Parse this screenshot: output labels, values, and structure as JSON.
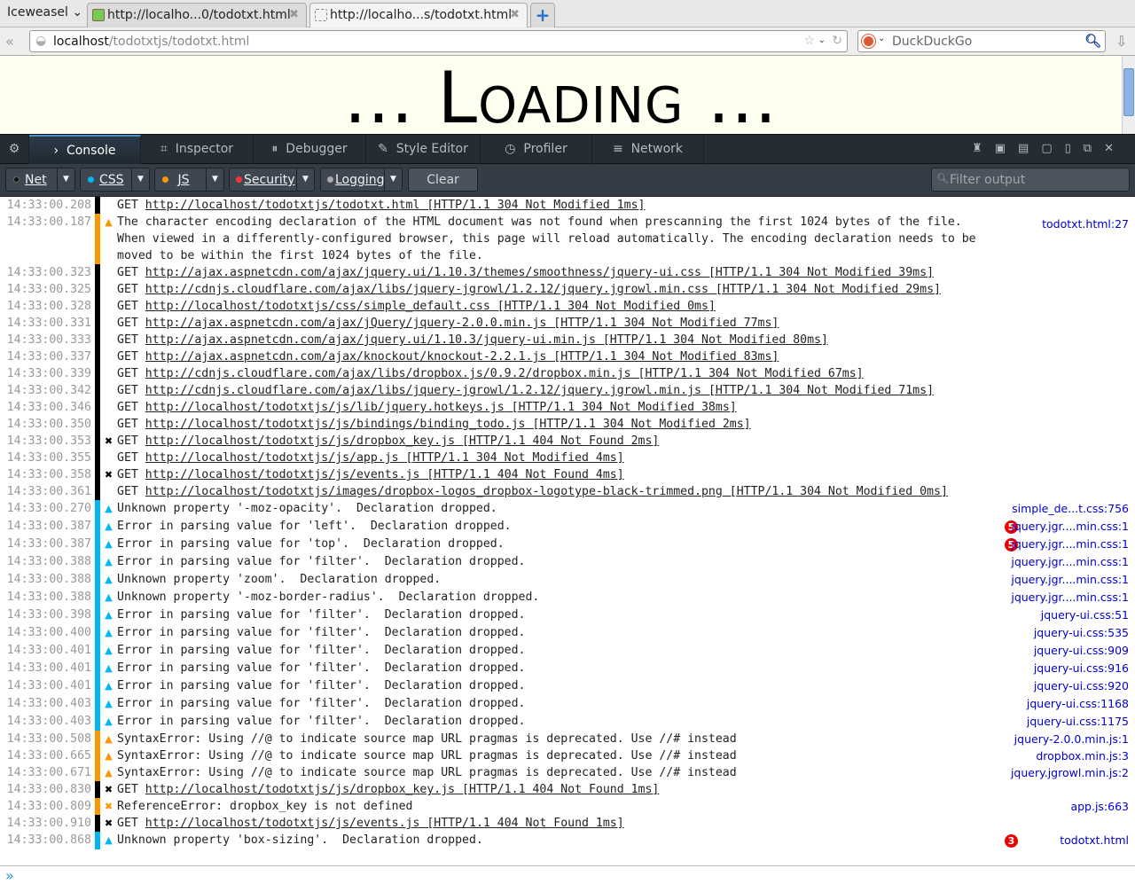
{
  "browser": {
    "app_menu": "Iceweasel",
    "tabs": [
      {
        "label": "http://localho...0/todotxt.html",
        "active": false
      },
      {
        "label": "http://localho...s/todotxt.html",
        "active": true
      }
    ],
    "url_host": "localhost",
    "url_path": "/todotxtjs/todotxt.html",
    "search_engine": "DuckDuckGo"
  },
  "page": {
    "loading_text": "... Loading ..."
  },
  "devtools": {
    "tools": [
      "Console",
      "Inspector",
      "Debugger",
      "Style Editor",
      "Profiler",
      "Network"
    ],
    "selected": "Console",
    "filters": [
      {
        "label": "Net",
        "color": "#222222"
      },
      {
        "label": "CSS",
        "color": "#00b6f0"
      },
      {
        "label": "JS",
        "color": "#fb9500"
      },
      {
        "label": "Security",
        "color": "#ff3333"
      },
      {
        "label": "Logging",
        "color": "#aaaaaa"
      }
    ],
    "clear_label": "Clear",
    "filter_placeholder": "Filter output"
  },
  "colors": {
    "net": "#000000",
    "js": "#fb9500",
    "css": "#00b6f0"
  },
  "log": [
    {
      "time": "14:33:00.208",
      "cat": "net",
      "icon": "",
      "pre": "GET ",
      "link": "http://localhost/todotxtjs/todotxt.html",
      "post": " [HTTP/1.1 304 Not Modified 1ms]",
      "loc": "",
      "badge": ""
    },
    {
      "time": "14:33:00.187",
      "cat": "js",
      "icon": "warn",
      "pre": "The character encoding declaration of the HTML document was not found when prescanning the first 1024 bytes of the file. When viewed in a differently-configured browser, this page will reload automatically. The encoding declaration needs to be moved to be within the first 1024 bytes of the file.",
      "link": "",
      "post": "",
      "loc": "todotxt.html:27",
      "badge": ""
    },
    {
      "time": "14:33:00.323",
      "cat": "net",
      "icon": "",
      "pre": "GET ",
      "link": "http://ajax.aspnetcdn.com/ajax/jquery.ui/1.10.3/themes/smoothness/jquery-ui.css",
      "post": " [HTTP/1.1 304 Not Modified 39ms]",
      "loc": "",
      "badge": ""
    },
    {
      "time": "14:33:00.325",
      "cat": "net",
      "icon": "",
      "pre": "GET ",
      "link": "http://cdnjs.cloudflare.com/ajax/libs/jquery-jgrowl/1.2.12/jquery.jgrowl.min.css",
      "post": " [HTTP/1.1 304 Not Modified 29ms]",
      "loc": "",
      "badge": ""
    },
    {
      "time": "14:33:00.328",
      "cat": "net",
      "icon": "",
      "pre": "GET ",
      "link": "http://localhost/todotxtjs/css/simple_default.css",
      "post": " [HTTP/1.1 304 Not Modified 0ms]",
      "loc": "",
      "badge": ""
    },
    {
      "time": "14:33:00.331",
      "cat": "net",
      "icon": "",
      "pre": "GET ",
      "link": "http://ajax.aspnetcdn.com/ajax/jQuery/jquery-2.0.0.min.js",
      "post": " [HTTP/1.1 304 Not Modified 77ms]",
      "loc": "",
      "badge": ""
    },
    {
      "time": "14:33:00.333",
      "cat": "net",
      "icon": "",
      "pre": "GET ",
      "link": "http://ajax.aspnetcdn.com/ajax/jquery.ui/1.10.3/jquery-ui.min.js",
      "post": " [HTTP/1.1 304 Not Modified 80ms]",
      "loc": "",
      "badge": ""
    },
    {
      "time": "14:33:00.337",
      "cat": "net",
      "icon": "",
      "pre": "GET ",
      "link": "http://ajax.aspnetcdn.com/ajax/knockout/knockout-2.2.1.js",
      "post": " [HTTP/1.1 304 Not Modified 83ms]",
      "loc": "",
      "badge": ""
    },
    {
      "time": "14:33:00.339",
      "cat": "net",
      "icon": "",
      "pre": "GET ",
      "link": "http://cdnjs.cloudflare.com/ajax/libs/dropbox.js/0.9.2/dropbox.min.js",
      "post": " [HTTP/1.1 304 Not Modified 67ms]",
      "loc": "",
      "badge": ""
    },
    {
      "time": "14:33:00.342",
      "cat": "net",
      "icon": "",
      "pre": "GET ",
      "link": "http://cdnjs.cloudflare.com/ajax/libs/jquery-jgrowl/1.2.12/jquery.jgrowl.min.js",
      "post": " [HTTP/1.1 304 Not Modified 71ms]",
      "loc": "",
      "badge": ""
    },
    {
      "time": "14:33:00.346",
      "cat": "net",
      "icon": "",
      "pre": "GET ",
      "link": "http://localhost/todotxtjs/js/lib/jquery.hotkeys.js",
      "post": " [HTTP/1.1 304 Not Modified 38ms]",
      "loc": "",
      "badge": ""
    },
    {
      "time": "14:33:00.350",
      "cat": "net",
      "icon": "",
      "pre": "GET ",
      "link": "http://localhost/todotxtjs/js/bindings/binding_todo.js",
      "post": " [HTTP/1.1 304 Not Modified 2ms]",
      "loc": "",
      "badge": ""
    },
    {
      "time": "14:33:00.353",
      "cat": "net",
      "icon": "error",
      "pre": "GET ",
      "link": "http://localhost/todotxtjs/js/dropbox_key.js",
      "post": " [HTTP/1.1 404 Not Found 2ms]",
      "loc": "",
      "badge": ""
    },
    {
      "time": "14:33:00.355",
      "cat": "net",
      "icon": "",
      "pre": "GET ",
      "link": "http://localhost/todotxtjs/js/app.js",
      "post": " [HTTP/1.1 304 Not Modified 4ms]",
      "loc": "",
      "badge": ""
    },
    {
      "time": "14:33:00.358",
      "cat": "net",
      "icon": "error",
      "pre": "GET ",
      "link": "http://localhost/todotxtjs/js/events.js",
      "post": " [HTTP/1.1 404 Not Found 4ms]",
      "loc": "",
      "badge": ""
    },
    {
      "time": "14:33:00.361",
      "cat": "net",
      "icon": "",
      "pre": "GET ",
      "link": "http://localhost/todotxtjs/images/dropbox-logos_dropbox-logotype-black-trimmed.png",
      "post": " [HTTP/1.1 304 Not Modified 0ms]",
      "loc": "",
      "badge": ""
    },
    {
      "time": "14:33:00.270",
      "cat": "css",
      "icon": "warn",
      "pre": "Unknown property '-moz-opacity'.  Declaration dropped.",
      "link": "",
      "post": "",
      "loc": "simple_de...t.css:756",
      "badge": ""
    },
    {
      "time": "14:33:00.387",
      "cat": "css",
      "icon": "warn",
      "pre": "Error in parsing value for 'left'.  Declaration dropped.",
      "link": "",
      "post": "",
      "loc": "jquery.jgr....min.css:1",
      "badge": "5"
    },
    {
      "time": "14:33:00.387",
      "cat": "css",
      "icon": "warn",
      "pre": "Error in parsing value for 'top'.  Declaration dropped.",
      "link": "",
      "post": "",
      "loc": "jquery.jgr....min.css:1",
      "badge": "5"
    },
    {
      "time": "14:33:00.388",
      "cat": "css",
      "icon": "warn",
      "pre": "Error in parsing value for 'filter'.  Declaration dropped.",
      "link": "",
      "post": "",
      "loc": "jquery.jgr....min.css:1",
      "badge": ""
    },
    {
      "time": "14:33:00.388",
      "cat": "css",
      "icon": "warn",
      "pre": "Unknown property 'zoom'.  Declaration dropped.",
      "link": "",
      "post": "",
      "loc": "jquery.jgr....min.css:1",
      "badge": ""
    },
    {
      "time": "14:33:00.388",
      "cat": "css",
      "icon": "warn",
      "pre": "Unknown property '-moz-border-radius'.  Declaration dropped.",
      "link": "",
      "post": "",
      "loc": "jquery.jgr....min.css:1",
      "badge": ""
    },
    {
      "time": "14:33:00.398",
      "cat": "css",
      "icon": "warn",
      "pre": "Error in parsing value for 'filter'.  Declaration dropped.",
      "link": "",
      "post": "",
      "loc": "jquery-ui.css:51",
      "badge": ""
    },
    {
      "time": "14:33:00.400",
      "cat": "css",
      "icon": "warn",
      "pre": "Error in parsing value for 'filter'.  Declaration dropped.",
      "link": "",
      "post": "",
      "loc": "jquery-ui.css:535",
      "badge": ""
    },
    {
      "time": "14:33:00.401",
      "cat": "css",
      "icon": "warn",
      "pre": "Error in parsing value for 'filter'.  Declaration dropped.",
      "link": "",
      "post": "",
      "loc": "jquery-ui.css:909",
      "badge": ""
    },
    {
      "time": "14:33:00.401",
      "cat": "css",
      "icon": "warn",
      "pre": "Error in parsing value for 'filter'.  Declaration dropped.",
      "link": "",
      "post": "",
      "loc": "jquery-ui.css:916",
      "badge": ""
    },
    {
      "time": "14:33:00.401",
      "cat": "css",
      "icon": "warn",
      "pre": "Error in parsing value for 'filter'.  Declaration dropped.",
      "link": "",
      "post": "",
      "loc": "jquery-ui.css:920",
      "badge": ""
    },
    {
      "time": "14:33:00.403",
      "cat": "css",
      "icon": "warn",
      "pre": "Error in parsing value for 'filter'.  Declaration dropped.",
      "link": "",
      "post": "",
      "loc": "jquery-ui.css:1168",
      "badge": ""
    },
    {
      "time": "14:33:00.403",
      "cat": "css",
      "icon": "warn",
      "pre": "Error in parsing value for 'filter'.  Declaration dropped.",
      "link": "",
      "post": "",
      "loc": "jquery-ui.css:1175",
      "badge": ""
    },
    {
      "time": "14:33:00.508",
      "cat": "js",
      "icon": "warn",
      "pre": "SyntaxError: Using //@ to indicate source map URL pragmas is deprecated. Use //# instead",
      "link": "",
      "post": "",
      "loc": "jquery-2.0.0.min.js:1",
      "badge": ""
    },
    {
      "time": "14:33:00.665",
      "cat": "js",
      "icon": "warn",
      "pre": "SyntaxError: Using //@ to indicate source map URL pragmas is deprecated. Use //# instead",
      "link": "",
      "post": "",
      "loc": "dropbox.min.js:3",
      "badge": ""
    },
    {
      "time": "14:33:00.671",
      "cat": "js",
      "icon": "warn",
      "pre": "SyntaxError: Using //@ to indicate source map URL pragmas is deprecated. Use //# instead",
      "link": "",
      "post": "",
      "loc": "jquery.jgrowl.min.js:2",
      "badge": ""
    },
    {
      "time": "14:33:00.830",
      "cat": "net",
      "icon": "error",
      "pre": "GET ",
      "link": "http://localhost/todotxtjs/js/dropbox_key.js",
      "post": " [HTTP/1.1 404 Not Found 1ms]",
      "loc": "",
      "badge": ""
    },
    {
      "time": "14:33:00.809",
      "cat": "js",
      "icon": "error",
      "pre": "ReferenceError: dropbox_key is not defined",
      "link": "",
      "post": "",
      "loc": "app.js:663",
      "badge": ""
    },
    {
      "time": "14:33:00.910",
      "cat": "net",
      "icon": "error",
      "pre": "GET ",
      "link": "http://localhost/todotxtjs/js/events.js",
      "post": " [HTTP/1.1 404 Not Found 1ms]",
      "loc": "",
      "badge": ""
    },
    {
      "time": "14:33:00.868",
      "cat": "css",
      "icon": "warn",
      "pre": "Unknown property 'box-sizing'.  Declaration dropped.",
      "link": "",
      "post": "",
      "loc": "todotxt.html",
      "badge": "3"
    }
  ]
}
